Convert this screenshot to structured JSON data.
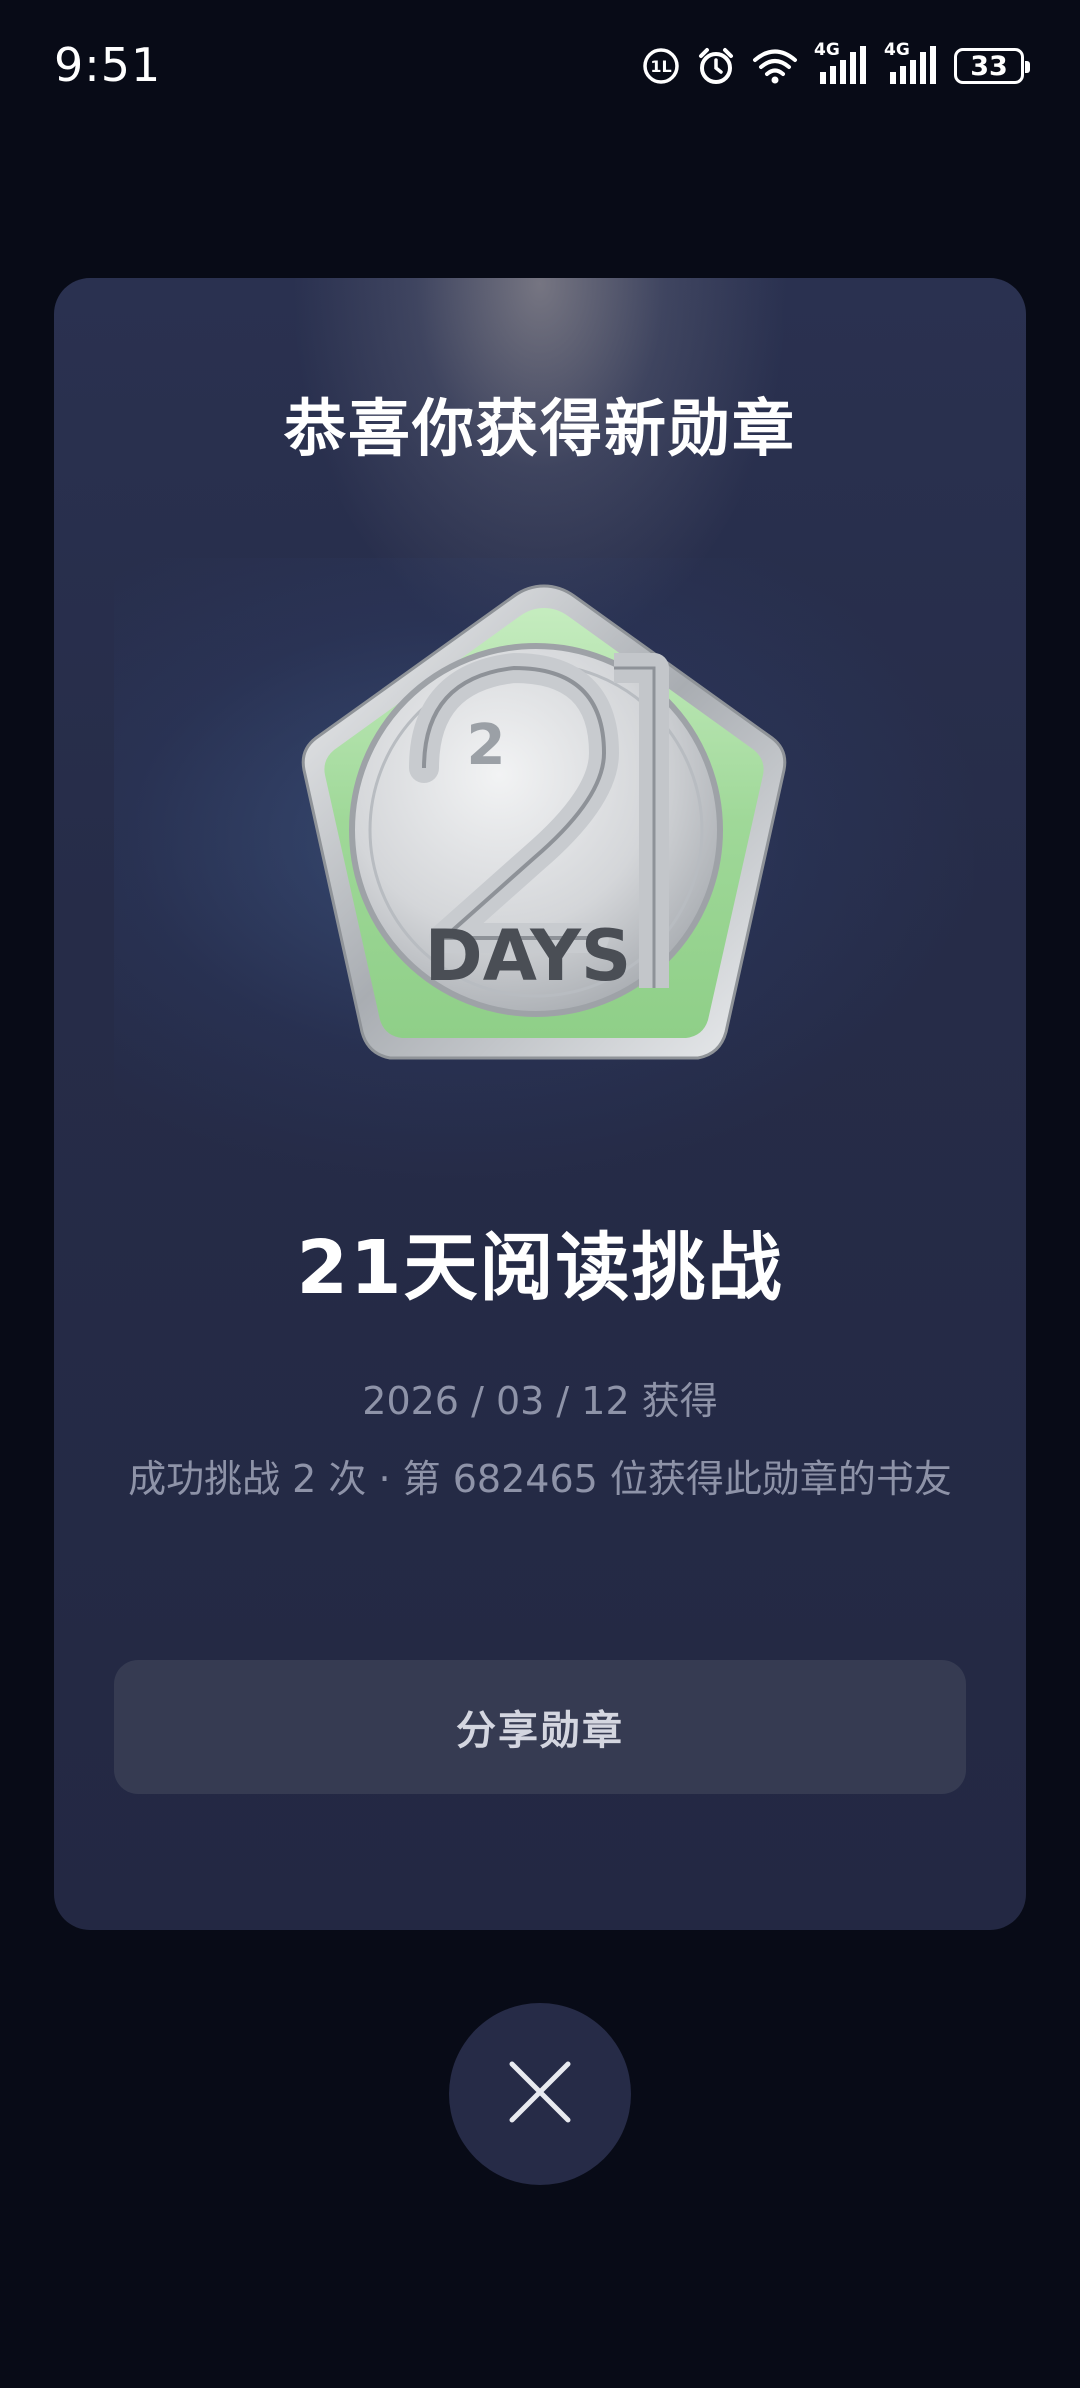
{
  "status_bar": {
    "time": "9:51",
    "network_1": "4G",
    "network_2": "4G",
    "battery_level": "33",
    "icons": [
      "hd-voice-icon",
      "alarm-icon",
      "wifi-icon",
      "signal-4g-icon",
      "signal-4g-icon",
      "battery-icon"
    ]
  },
  "card": {
    "title": "恭喜你获得新勋章",
    "badge": {
      "icon": "21-days-badge",
      "big_number": "2",
      "small_number": "2",
      "label": "DAYS",
      "colors": {
        "inner": "#a9dca3",
        "rim": "#d9dbdc"
      }
    },
    "badge_name": "21天阅读挑战",
    "date_text": "2026 / 03 / 12 获得",
    "stats_text": "成功挑战 2 次 · 第 682465 位获得此勋章的书友",
    "share_label": "分享勋章"
  },
  "close": {
    "icon": "close-icon"
  },
  "colors": {
    "background": "#080b17",
    "card": "#262c48",
    "button": "#363b52",
    "muted_text": "#8e93a8"
  }
}
